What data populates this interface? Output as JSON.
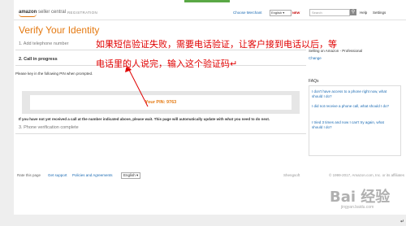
{
  "header": {
    "logo_main": "amazon",
    "logo_sub": "seller central",
    "registration": "REGISTRATION",
    "choose_merchant": "Choose Merchant",
    "language": "English ▾",
    "new_badge": "NEW",
    "search_placeholder": "Search",
    "help": "Help",
    "settings": "Settings"
  },
  "main": {
    "title": "Verify Your Identity",
    "step1": "1. Add telephone number",
    "step2": "2. Call in progress",
    "pin_prompt": "Please key in the following PIN when prompted.",
    "pin_label": "Your PIN: 9763",
    "wait_text": "If you have not yet received a call at the number indicated above, please wait. This page will automatically update with what you need to do next.",
    "step3": "3. Phone verification complete"
  },
  "sidebar": {
    "selling_plan": "Selling on Amazon - Professional",
    "change_link": "Change",
    "faqs_heading": "FAQs",
    "faqs": [
      "I don't have access to a phone right now, what should I do?",
      "I did not receive a phone call, what should I do?",
      "I tried 3 times and now I can't try again, what should I do?"
    ]
  },
  "footer": {
    "rate_page": "Rate this page",
    "get_support": "Get support",
    "policies": "Policies and Agreements",
    "language": "English ▾",
    "shengsoft": "Shengsoft",
    "copyright": "© 1999-2017, Amazon.com, Inc. or its affiliates"
  },
  "annotation": {
    "line1": "如果短信验证失败，需要电话验证，让客户接到电话以后，等",
    "line2": "电话里的人说完，输入这个验证码↵"
  },
  "watermark": {
    "main": "Bai 经验",
    "sub": "jingyan.baidu.com"
  },
  "colors": {
    "accent_orange": "#e47911",
    "link_blue": "#1a6ab3",
    "annotation_red": "#e00000"
  }
}
